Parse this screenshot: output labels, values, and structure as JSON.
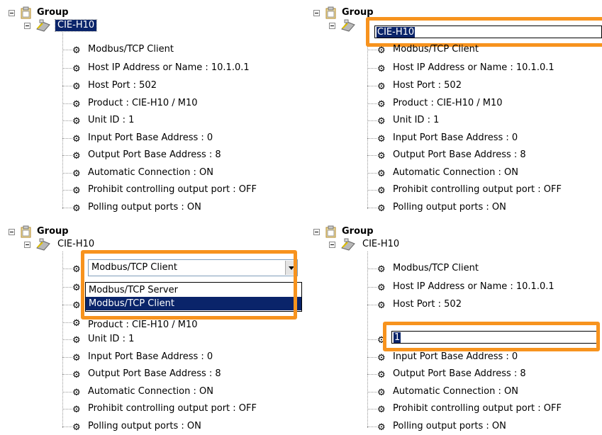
{
  "group_label": "Group",
  "device_label": "CIE-H10",
  "items": [
    "Modbus/TCP Client",
    "Host IP Address or Name : 10.1.0.1",
    "Host Port : 502",
    "Product : CIE-H10 / M10",
    "Unit ID : 1",
    "Input Port Base Address : 0",
    "Output Port Base Address : 8",
    "Automatic Connection : ON",
    "Prohibit controlling output port : OFF",
    "Polling output ports : ON"
  ],
  "rename_edit_value": "CIE-H10",
  "protocol_combo": {
    "value": "Modbus/TCP Client",
    "options": [
      "Modbus/TCP Server",
      "Modbus/TCP Client"
    ],
    "selected_option": "Modbus/TCP Client"
  },
  "unit_id_edit_value": "1",
  "colors": {
    "highlight": "#f7931e",
    "selection": "#0a246a"
  },
  "icons": [
    "collapse-icon",
    "group-icon",
    "device-icon",
    "gear-icon",
    "dropdown-arrow-icon"
  ]
}
